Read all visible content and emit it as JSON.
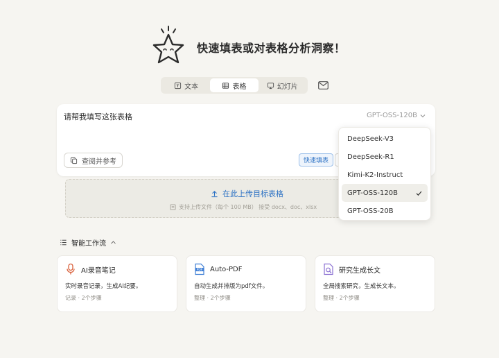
{
  "hero": {
    "title": "快速填表或对表格分析洞察！"
  },
  "tabs": [
    {
      "label": "文本",
      "icon": "text-doc-icon"
    },
    {
      "label": "表格",
      "icon": "table-icon",
      "active": true
    },
    {
      "label": "幻灯片",
      "icon": "slides-icon"
    }
  ],
  "composer": {
    "input_value": "请帮我填写这张表格",
    "model_selected": "GPT-OSS-120B",
    "reference_button": "查阅并参考",
    "quick_fill_chip": "快速填表"
  },
  "upload": {
    "title": "在此上传目标表格",
    "subtitle": "支持上传文件（每个 100 MB） 接受 docx、doc、xlsx"
  },
  "model_dropdown": {
    "options": [
      "DeepSeek-V3",
      "DeepSeek-R1",
      "Kimi-K2-Instruct",
      "GPT-OSS-120B",
      "GPT-OSS-20B"
    ],
    "selected_index": 3
  },
  "workflows": {
    "header": "智能工作流",
    "cards": [
      {
        "title": "AI录音笔记",
        "desc": "实时录音记录，生成AI纪要。",
        "meta": "记录 · 2个步骤",
        "icon": "microphone-icon"
      },
      {
        "title": "Auto-PDF",
        "desc": "自动生成并排版为pdf文件。",
        "meta": "整理 · 2个步骤",
        "icon": "pdf-file-icon"
      },
      {
        "title": "研究生成长文",
        "desc": "全局搜索研究，生成长文本。",
        "meta": "整理 · 2个步骤",
        "icon": "doc-search-icon"
      }
    ]
  },
  "colors": {
    "accent_blue": "#2d72c4",
    "background": "#f6f5f1",
    "mic_accent": "#d9603b",
    "pdf_accent": "#3f7fd6",
    "search_accent": "#8a6fd1"
  }
}
